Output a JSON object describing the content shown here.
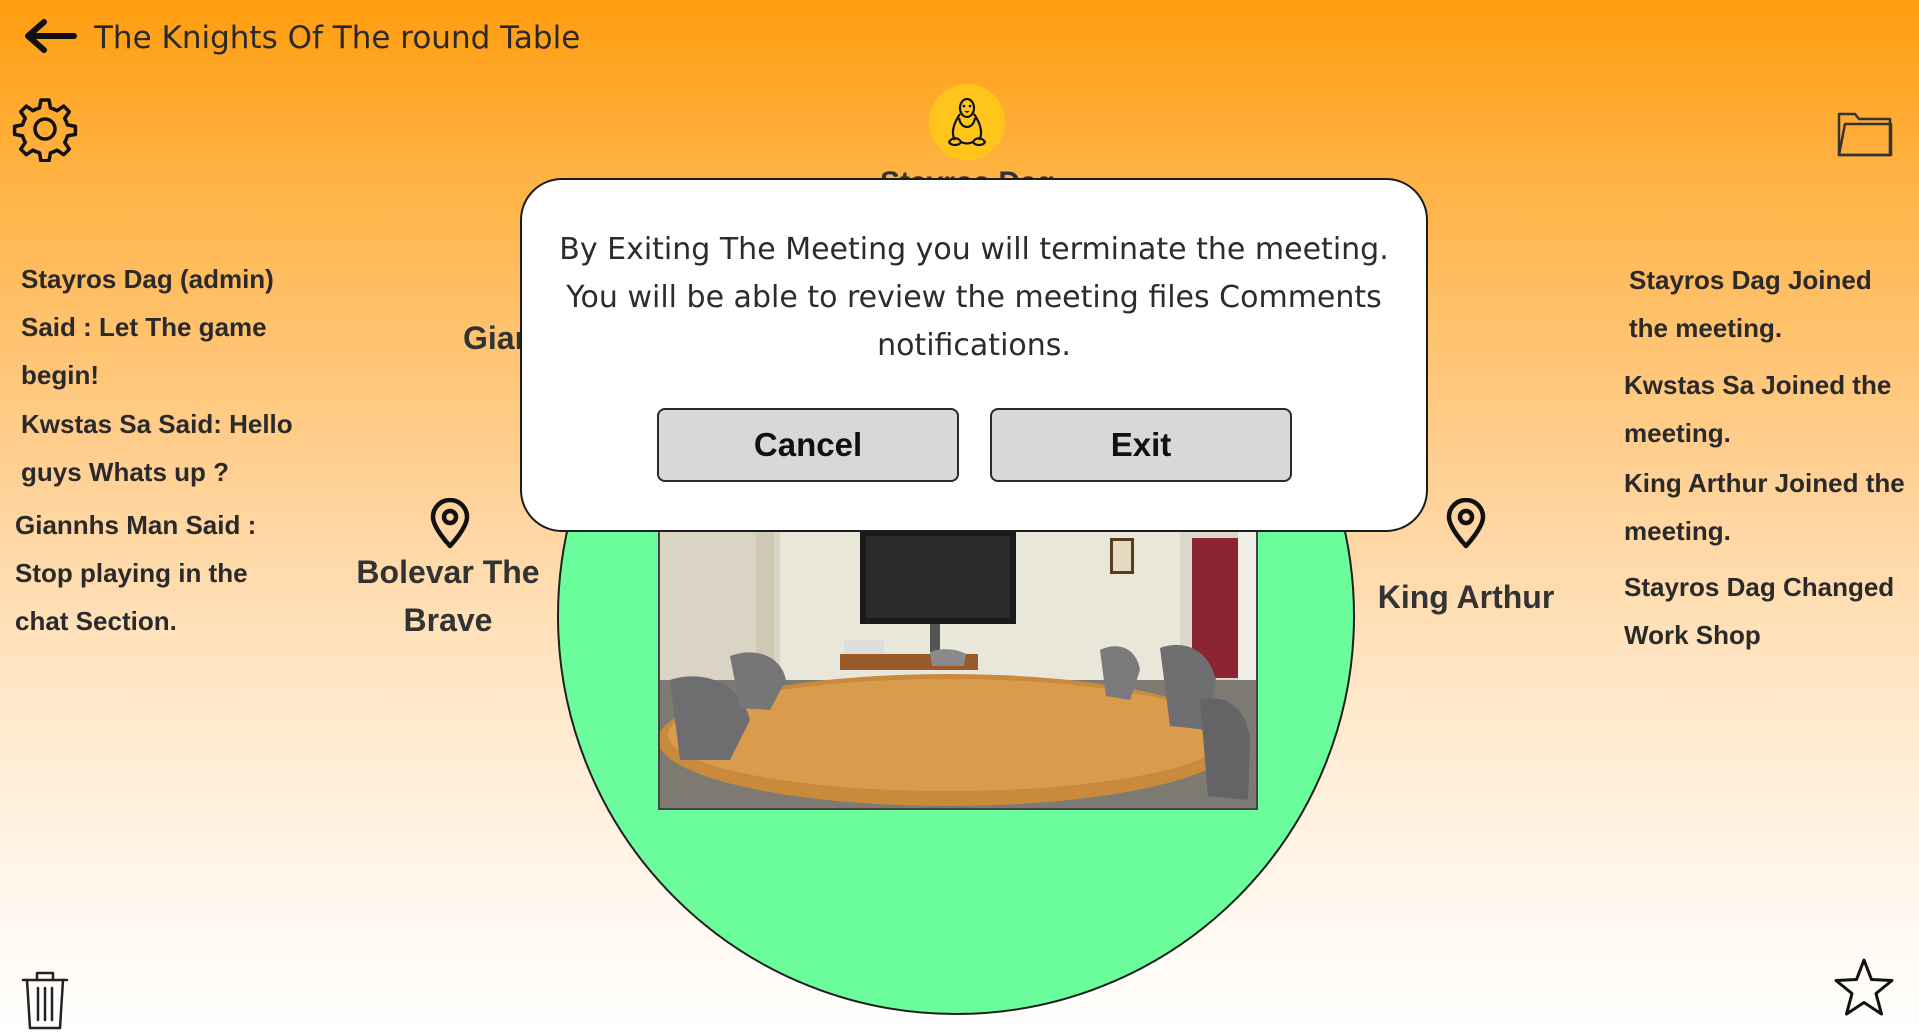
{
  "header": {
    "title": "The Knights Of The round Table",
    "back_icon": "arrow-left-icon"
  },
  "toolbar": {
    "settings_icon": "gear-icon",
    "files_icon": "folder-icon",
    "delete_icon": "trash-icon",
    "favorite_icon": "star-icon"
  },
  "chat": {
    "lines": [
      "Stayros Dag (admin)",
      "Said : Let The game",
      "begin!",
      "Kwstas Sa Said: Hello",
      "guys Whats up ?",
      "Giannhs Man Said :",
      "Stop playing in the",
      "chat Section."
    ]
  },
  "activity": {
    "lines": [
      "Stayros Dag Joined",
      "the meeting.",
      "Kwstas Sa Joined the",
      "meeting.",
      "King Arthur Joined the",
      "meeting.",
      "Stayros Dag Changed",
      "Work Shop"
    ]
  },
  "participants": {
    "admin": {
      "name_partial": "Stayros Dag",
      "avatar_icon": "linux-penguin-icon",
      "avatar_color": "#ffc51a"
    },
    "left_top_partial": "Giar",
    "left": {
      "name_line1": "Bolevar The",
      "name_line2": "Brave",
      "pin_icon": "location-pin-icon"
    },
    "right": {
      "name": "King Arthur",
      "pin_icon": "location-pin-icon"
    }
  },
  "table": {
    "color": "#6bfd9b",
    "image_alt": "conference-room-photo"
  },
  "dialog": {
    "message_line1": "By Exiting The Meeting you will terminate the meeting.",
    "message_line2": "You will be able to review the meeting files Comments",
    "message_line3": "notifications.",
    "cancel_label": "Cancel",
    "exit_label": "Exit"
  },
  "colors": {
    "header_orange": "#ff9d0f",
    "button_gray": "#d8d8d8"
  }
}
